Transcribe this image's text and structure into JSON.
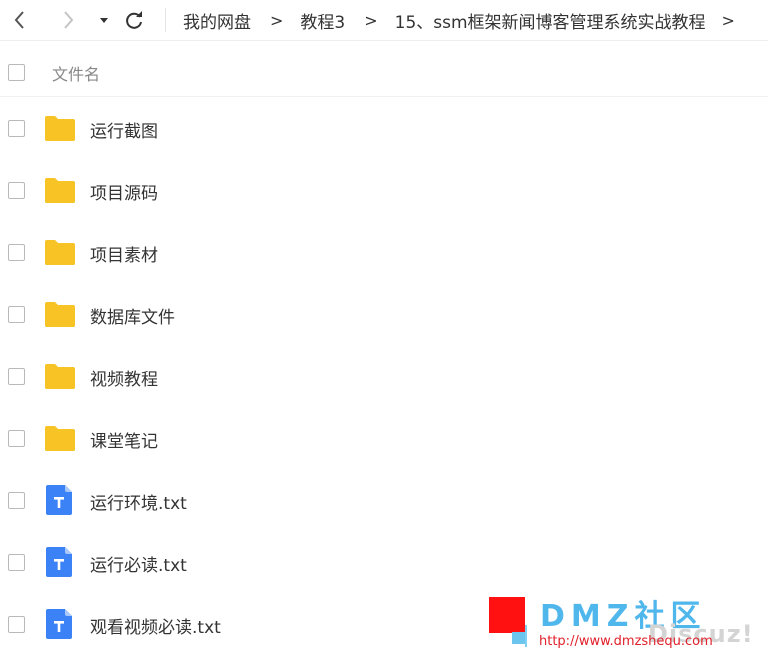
{
  "toolbar": {
    "breadcrumbs": [
      "我的网盘",
      "教程3",
      "15、ssm框架新闻博客管理系统实战教程"
    ],
    "separator": ">"
  },
  "header": {
    "column_name": "文件名"
  },
  "files": [
    {
      "name": "运行截图",
      "type": "folder-icon"
    },
    {
      "name": "项目源码",
      "type": "folder-icon"
    },
    {
      "name": "项目素材",
      "type": "folder-icon"
    },
    {
      "name": "数据库文件",
      "type": "folder-icon"
    },
    {
      "name": "视频教程",
      "type": "folder-icon"
    },
    {
      "name": "课堂笔记",
      "type": "folder-icon"
    },
    {
      "name": "运行环境.txt",
      "type": "text-file-icon"
    },
    {
      "name": "运行必读.txt",
      "type": "text-file-icon"
    },
    {
      "name": "观看视频必读.txt",
      "type": "text-file-icon"
    }
  ],
  "watermark": {
    "title": "DMZ社区",
    "url": "http://www.dmzshequ.com",
    "brand": "Discuz!"
  },
  "colors": {
    "folder": "#f7c325",
    "text_file": "#3b82f6",
    "checkbox_border": "#b9b9b9"
  }
}
